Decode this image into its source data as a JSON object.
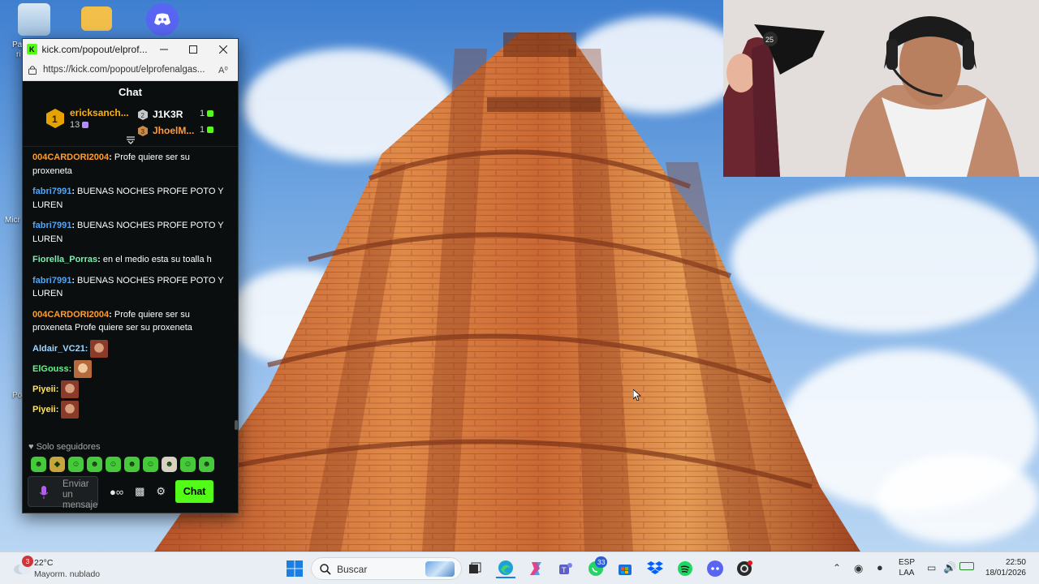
{
  "browser": {
    "tab_title": "kick.com/popout/elprof...",
    "url": "https://kick.com/popout/elprofenalgas...",
    "favicon_letter": "K"
  },
  "chat": {
    "header": "Chat",
    "gifters": [
      {
        "rank": "1",
        "name": "ericksanch...",
        "count": "13",
        "color": "#ffb300"
      },
      {
        "rank": "2",
        "name": "J1K3R",
        "count": "1",
        "color": "#ffffff"
      },
      {
        "rank": "3",
        "name": "JhoelM...",
        "count": "1",
        "color": "#ff9a3c"
      }
    ],
    "messages": [
      {
        "user": "004CARDORI2004",
        "color": "#ff9d2e",
        "text": " Profe quiere ser su proxeneta"
      },
      {
        "user": "fabri7991",
        "color": "#4aa8ff",
        "text": " BUENAS NOCHES PROFE POTO Y LUREN"
      },
      {
        "user": "fabri7991",
        "color": "#4aa8ff",
        "text": " BUENAS NOCHES PROFE POTO Y LUREN"
      },
      {
        "user": "Fiorella_Porras",
        "color": "#7df0b0",
        "text": " en el medio esta su toalla h"
      },
      {
        "user": "fabri7991",
        "color": "#4aa8ff",
        "text": " BUENAS NOCHES PROFE POTO Y LUREN"
      },
      {
        "user": "004CARDORI2004",
        "color": "#ff9d2e",
        "text": " Profe quiere ser su proxeneta Profe quiere ser su proxeneta"
      }
    ],
    "emote_messages": [
      {
        "user": "Aldair_VC21:",
        "color": "#9fd6ff"
      },
      {
        "user": "ElGouss:",
        "color": "#63f58a"
      },
      {
        "user": "Piyeii:",
        "color": "#ffe45c"
      },
      {
        "user": "Piyeii:",
        "color": "#ffe45c"
      }
    ],
    "mode_label": "Solo seguidores",
    "input_placeholder": "Enviar un mensaje",
    "send_label": "Chat",
    "accent": "#53fc18"
  },
  "taskbar": {
    "weather_temp": "22°C",
    "weather_desc": "Mayorm. nublado",
    "weather_badge": "3",
    "search_placeholder": "Buscar",
    "whatsapp_badge": "33",
    "language": "ESP",
    "layout": "LAA",
    "time": "22:50",
    "date": "18/01/2026"
  },
  "desktop": {
    "labels": [
      "Pa",
      "ri",
      "Micr",
      "Po"
    ]
  }
}
